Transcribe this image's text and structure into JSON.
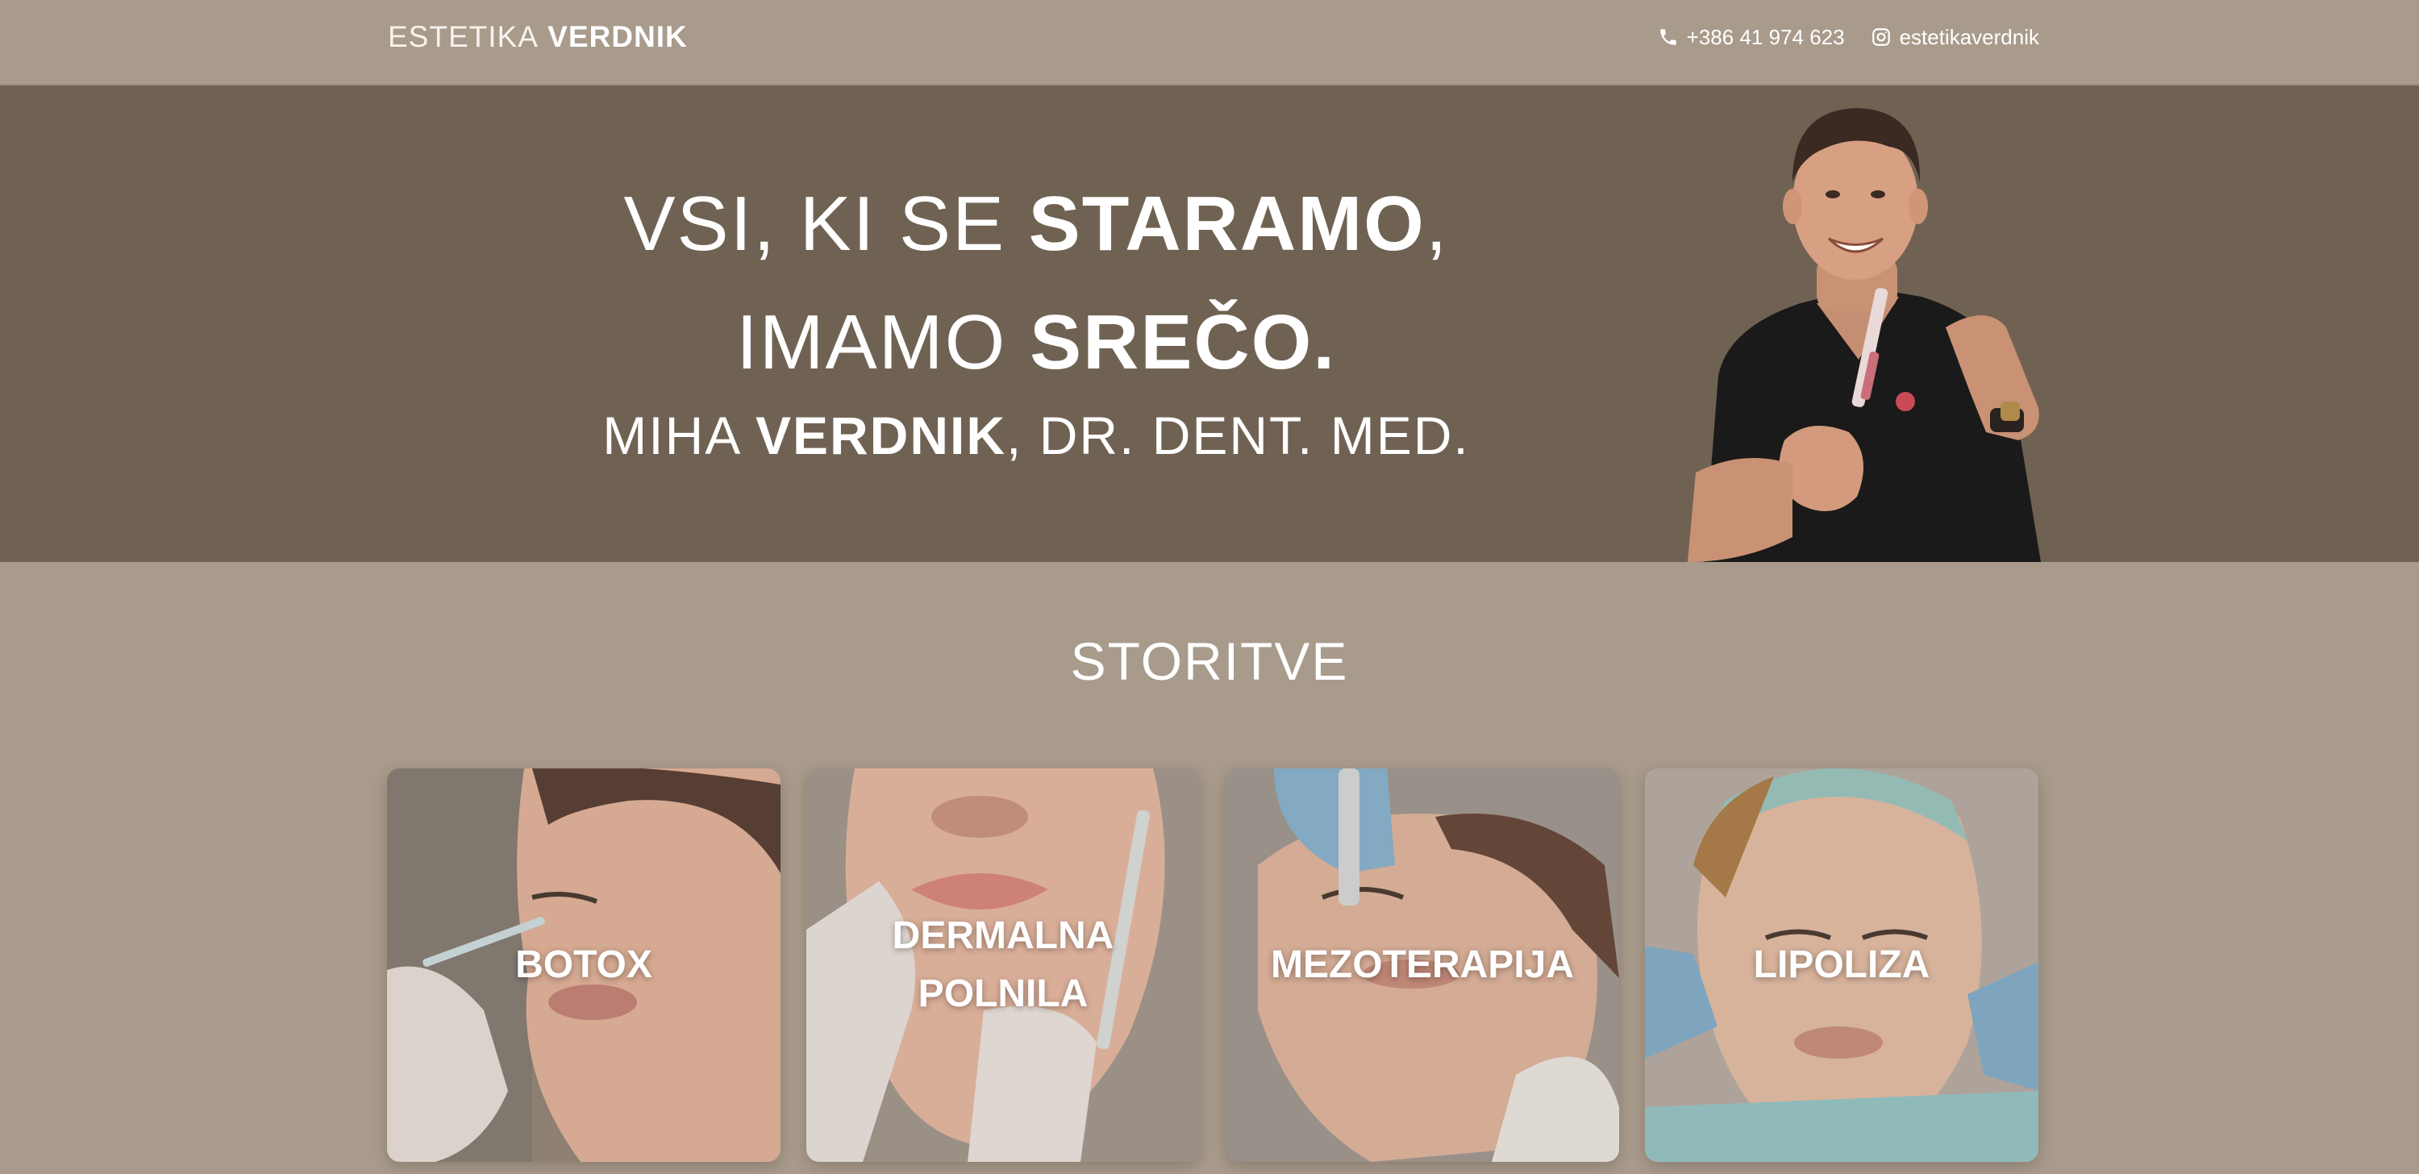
{
  "header": {
    "brand_light": "ESTETIKA",
    "brand_bold": "VERDNIK",
    "phone": "+386 41 974 623",
    "instagram": "estetikaverdnik"
  },
  "hero": {
    "line1_light": "VSI, KI SE",
    "line1_bold": "STARAMO",
    "line1_end": ",",
    "line2_light": "IMAMO",
    "line2_bold": "SREČO.",
    "line3_light": "MIHA",
    "line3_bold": "VERDNIK",
    "line3_end": ", DR. DENT. MED."
  },
  "services": {
    "title": "STORITVE",
    "items": [
      {
        "label": "BOTOX"
      },
      {
        "label": "DERMALNA POLNILA"
      },
      {
        "label": "MEZOTERAPIJA"
      },
      {
        "label": "LIPOLIZA"
      }
    ]
  },
  "colors": {
    "page_bg": "#a89b8c",
    "hero_bg": "#706253",
    "text": "#ffffff"
  },
  "icons": {
    "phone": "phone-icon",
    "instagram": "instagram-icon"
  }
}
